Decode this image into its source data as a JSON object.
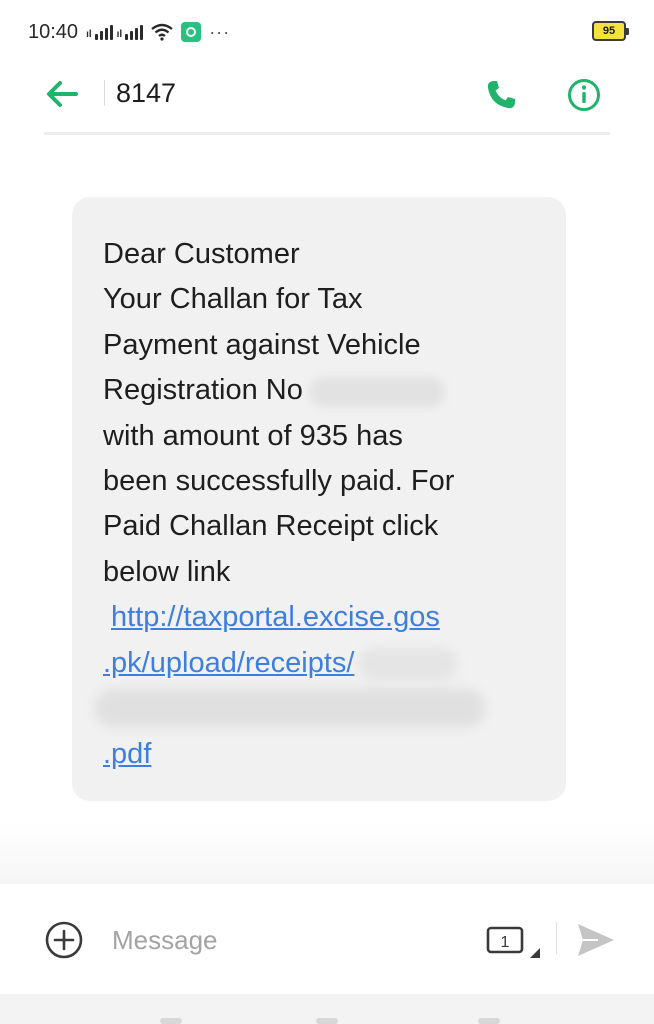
{
  "status_bar": {
    "time": "10:40",
    "signal_icons": [
      "signal-bars-icon",
      "signal-bars-icon"
    ],
    "wifi_icon": "wifi-icon",
    "app_icon": "messenger-app-icon",
    "more_indicator": "···",
    "battery_level": "95",
    "battery_color": "#f5e23c"
  },
  "header": {
    "back_icon": "arrow-left-icon",
    "title": "8147",
    "call_icon": "phone-icon",
    "info_icon": "info-icon",
    "accent_color": "#1fb36b"
  },
  "message": {
    "lines": [
      "Dear Customer",
      "Your Challan for Tax",
      "Payment against Vehicle",
      "Registration No",
      "with amount of 935 has",
      "been successfully paid. For",
      "Paid Challan Receipt click",
      "below link"
    ],
    "link_lines": [
      "http://taxportal.excise.gos",
      ".pk/upload/receipts/",
      ".pdf"
    ],
    "link_color": "#3f7fdc",
    "bubble_color": "#f1f1f1"
  },
  "composer": {
    "add_icon": "plus-circle-icon",
    "placeholder": "Message",
    "value": "",
    "sim_icon": "sim-card-icon",
    "sim_label": "1",
    "send_icon": "send-icon"
  }
}
